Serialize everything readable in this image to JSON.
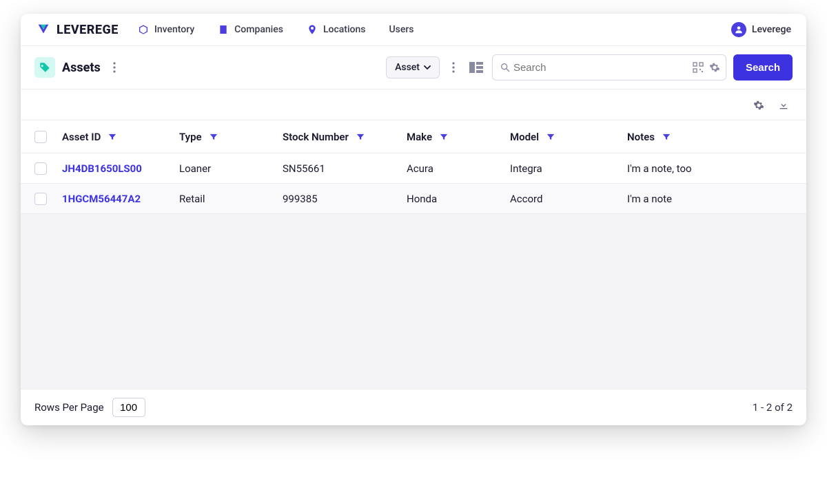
{
  "brand": {
    "name": "LEVEREGE"
  },
  "nav": {
    "items": [
      {
        "icon": "cube",
        "purple": true,
        "label": "Inventory"
      },
      {
        "icon": "building",
        "purple": true,
        "label": "Companies"
      },
      {
        "icon": "pin",
        "purple": true,
        "label": "Locations"
      },
      {
        "icon": "",
        "purple": false,
        "label": "Users"
      }
    ],
    "user_name": "Leverege"
  },
  "toolbar": {
    "page_title": "Assets",
    "dropdown_label": "Asset",
    "search_placeholder": "Search",
    "search_button": "Search"
  },
  "table": {
    "headers": {
      "asset_id": "Asset ID",
      "type": "Type",
      "stock_number": "Stock Number",
      "make": "Make",
      "model": "Model",
      "notes": "Notes"
    },
    "rows": [
      {
        "asset_id": "JH4DB1650LS00",
        "type": "Loaner",
        "stock_number": "SN55661",
        "make": "Acura",
        "model": "Integra",
        "notes": "I'm a note, too"
      },
      {
        "asset_id": "1HGCM56447A2",
        "type": "Retail",
        "stock_number": "999385",
        "make": "Honda",
        "model": "Accord",
        "notes": "I'm a note"
      }
    ]
  },
  "footer": {
    "rows_per_page_label": "Rows Per Page",
    "rows_per_page_value": "100",
    "page_status": "1 - 2 of 2"
  }
}
